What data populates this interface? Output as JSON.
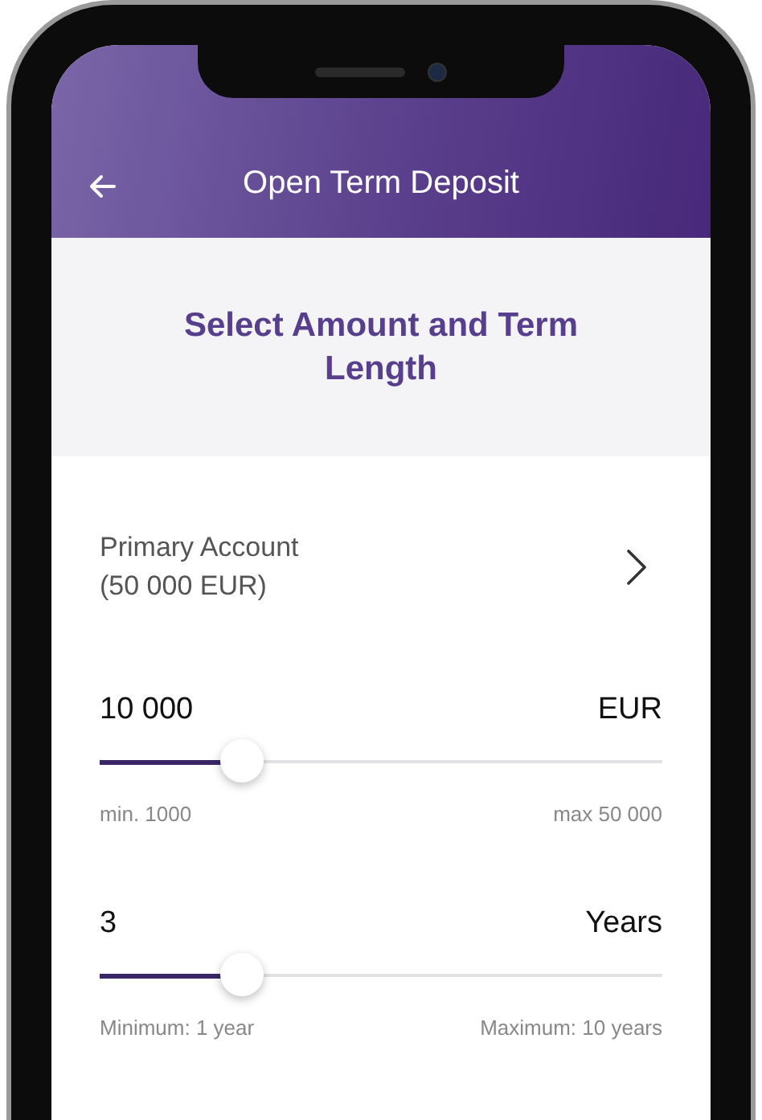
{
  "header": {
    "title": "Open Term Deposit"
  },
  "heading": "Select Amount and Term Length",
  "account": {
    "name": "Primary Account",
    "balance": "(50 000 EUR)"
  },
  "sliders": [
    {
      "value": "10 000",
      "unit": "EUR",
      "level": 0.25,
      "min_label": "min. 1000",
      "max_label": "max 50 000"
    },
    {
      "value": "3",
      "unit": "Years",
      "level": 0.25,
      "min_label": "Minimum: 1 year",
      "max_label": "Maximum: 10 years"
    }
  ]
}
